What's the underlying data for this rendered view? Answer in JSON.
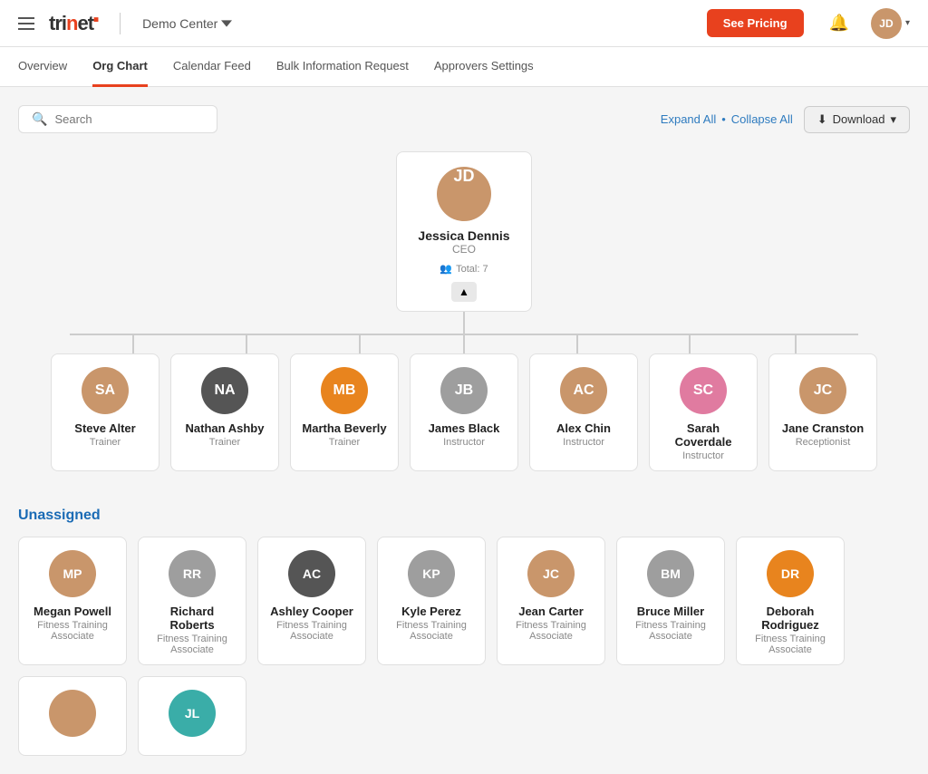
{
  "topNav": {
    "logo": "trinet",
    "logoAccent": "■",
    "demoCenter": "Demo Center",
    "seePricing": "See Pricing",
    "pricingNav": "Pricing"
  },
  "subNav": {
    "items": [
      {
        "label": "Overview",
        "active": false
      },
      {
        "label": "Org Chart",
        "active": true
      },
      {
        "label": "Calendar Feed",
        "active": false
      },
      {
        "label": "Bulk Information Request",
        "active": false
      },
      {
        "label": "Approvers Settings",
        "active": false
      }
    ]
  },
  "toolbar": {
    "searchPlaceholder": "Search",
    "expandAll": "Expand All",
    "collapseAll": "Collapse All",
    "download": "Download"
  },
  "ceo": {
    "name": "Jessica Dennis",
    "title": "CEO",
    "total": "Total: 7"
  },
  "teamMembers": [
    {
      "name": "Steve Alter",
      "role": "Trainer",
      "avatarColor": "av-brown",
      "initials": "SA"
    },
    {
      "name": "Nathan Ashby",
      "role": "Trainer",
      "avatarColor": "av-dark",
      "initials": "NA"
    },
    {
      "name": "Martha Beverly",
      "role": "Trainer",
      "avatarColor": "av-orange",
      "initials": "MB"
    },
    {
      "name": "James Black",
      "role": "Instructor",
      "avatarColor": "av-gray",
      "initials": "JB"
    },
    {
      "name": "Alex Chin",
      "role": "Instructor",
      "avatarColor": "av-brown",
      "initials": "AC"
    },
    {
      "name": "Sarah Coverdale",
      "role": "Instructor",
      "avatarColor": "av-pink",
      "initials": "SC"
    },
    {
      "name": "Jane Cranston",
      "role": "Receptionist",
      "avatarColor": "av-brown",
      "initials": "JC"
    }
  ],
  "unassigned": {
    "title": "Unassigned",
    "members": [
      {
        "name": "Megan Powell",
        "role": "Fitness Training Associate",
        "avatarColor": "av-brown",
        "initials": "MP"
      },
      {
        "name": "Richard Roberts",
        "role": "Fitness Training Associate",
        "avatarColor": "av-gray",
        "initials": "RR"
      },
      {
        "name": "Ashley Cooper",
        "role": "Fitness Training Associate",
        "avatarColor": "av-dark",
        "initials": "AC"
      },
      {
        "name": "Kyle Perez",
        "role": "Fitness Training Associate",
        "avatarColor": "av-gray",
        "initials": "KP"
      },
      {
        "name": "Jean Carter",
        "role": "Fitness Training Associate",
        "avatarColor": "av-brown",
        "initials": "JC"
      },
      {
        "name": "Bruce Miller",
        "role": "Fitness Training Associate",
        "avatarColor": "av-gray",
        "initials": "BM"
      },
      {
        "name": "Deborah Rodriguez",
        "role": "Fitness Training Associate",
        "avatarColor": "av-orange",
        "initials": "DR"
      }
    ]
  },
  "secondRowUnassigned": [
    {
      "name": "",
      "role": "",
      "avatarColor": "av-brown",
      "initials": ""
    },
    {
      "name": "JL",
      "role": "",
      "avatarColor": "av-teal",
      "initials": "JL"
    }
  ]
}
